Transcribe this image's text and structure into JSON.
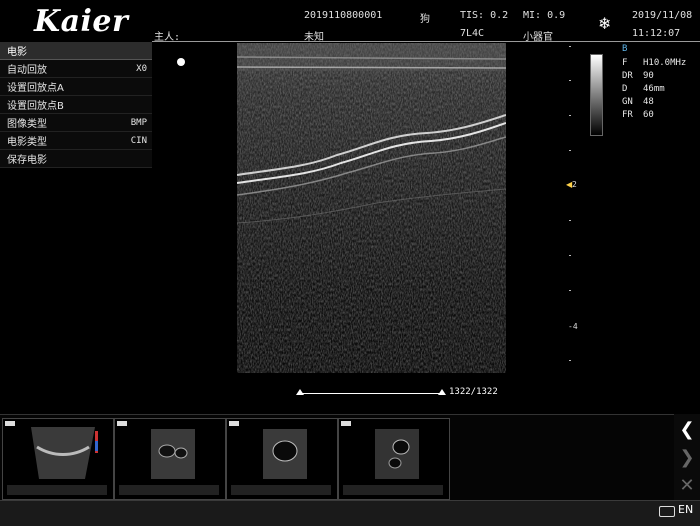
{
  "header": {
    "logo": "Kaier",
    "patient_id": "2019110800001",
    "species": "狗",
    "tis": "TIS: 0.2",
    "mi": "MI: 0.9",
    "date": "2019/11/08",
    "owner_label": "主人:",
    "owner_name": "未知",
    "probe": "7L4C",
    "preset": "小器官",
    "time": "11:12:07",
    "freeze_icon": "snowflake-icon"
  },
  "menu": {
    "title": "电影",
    "items": [
      {
        "label": "自动回放",
        "value": "X0"
      },
      {
        "label": "设置回放点A",
        "value": ""
      },
      {
        "label": "设置回放点B",
        "value": ""
      },
      {
        "label": "图像类型",
        "value": "BMP"
      },
      {
        "label": "电影类型",
        "value": "CIN"
      },
      {
        "label": "保存电影",
        "value": ""
      }
    ]
  },
  "params": {
    "mode": "B",
    "rows": [
      {
        "key": "F",
        "value": "H10.0MHz"
      },
      {
        "key": "DR",
        "value": "90"
      },
      {
        "key": "D",
        "value": "46mm"
      },
      {
        "key": "GN",
        "value": "48"
      },
      {
        "key": "FR",
        "value": "60"
      }
    ]
  },
  "depth_scale": {
    "labels": [
      "-",
      "2",
      "-",
      "4",
      "-"
    ],
    "focus_depth": "2"
  },
  "cine": {
    "frame_counter": "1322/1322"
  },
  "thumbnails": [
    {
      "name": "thumb-1"
    },
    {
      "name": "thumb-2"
    },
    {
      "name": "thumb-3"
    },
    {
      "name": "thumb-4"
    }
  ],
  "nav": {
    "prev": "❮",
    "next": "❯",
    "delete": "✕"
  },
  "status": {
    "language": "EN",
    "keyboard_icon": "keyboard-icon"
  }
}
